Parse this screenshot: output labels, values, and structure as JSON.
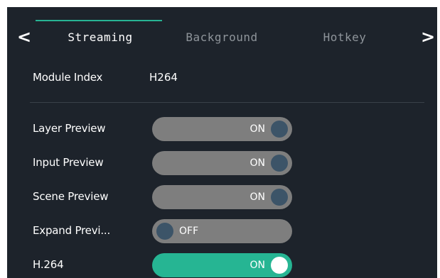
{
  "tabs": {
    "prev_arrow": "<",
    "next_arrow": ">",
    "items": [
      {
        "label": "Streaming",
        "active": true
      },
      {
        "label": "Background",
        "active": false
      },
      {
        "label": "Hotkey",
        "active": false
      }
    ]
  },
  "module": {
    "label": "Module Index",
    "value": "H264"
  },
  "settings": [
    {
      "label": "Layer Preview",
      "state": "ON"
    },
    {
      "label": "Input Preview",
      "state": "ON"
    },
    {
      "label": "Scene Preview",
      "state": "ON"
    },
    {
      "label": "Expand Previ...",
      "state": "OFF"
    },
    {
      "label": "H.264",
      "state": "ON"
    }
  ],
  "colors": {
    "background": "#1d232b",
    "accent": "#26b593",
    "toggle_track": "#7e7e7e",
    "toggle_knob": "#3c5468"
  }
}
